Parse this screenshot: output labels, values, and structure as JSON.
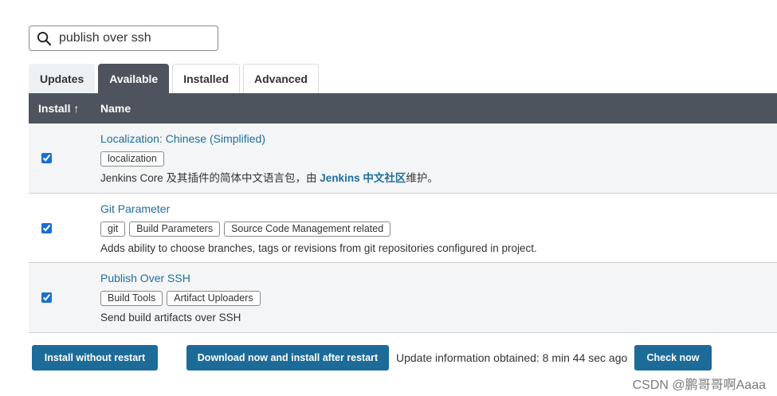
{
  "search": {
    "value": "publish over ssh",
    "icon": "search-icon"
  },
  "tabs": [
    {
      "label": "Updates",
      "active": false
    },
    {
      "label": "Available",
      "active": true
    },
    {
      "label": "Installed",
      "active": false
    },
    {
      "label": "Advanced",
      "active": false
    }
  ],
  "table": {
    "headers": {
      "install": "Install ↑",
      "name": "Name"
    },
    "rows": [
      {
        "name": "Localization: Chinese (Simplified)",
        "checked": true,
        "labels": [
          "localization"
        ],
        "description_prefix": "Jenkins Core 及其插件的简体中文语言包，由 ",
        "description_link": "Jenkins 中文社区",
        "description_suffix": "维护。"
      },
      {
        "name": "Git Parameter",
        "checked": true,
        "labels": [
          "git",
          "Build Parameters",
          "Source Code Management related"
        ],
        "description": "Adds ability to choose branches, tags or revisions from git repositories configured in project."
      },
      {
        "name": "Publish Over SSH",
        "checked": true,
        "labels": [
          "Build Tools",
          "Artifact Uploaders"
        ],
        "description": "Send build artifacts over SSH"
      }
    ]
  },
  "footer": {
    "install_button": "Install without restart",
    "download_button": "Download now and install after restart",
    "update_info": "Update information obtained: 8 min 44 sec ago",
    "check_button": "Check now"
  },
  "watermark": "CSDN @鹏哥哥啊Aaaa",
  "colors": {
    "header_bg": "#4d545d",
    "button_bg": "#1d6b99",
    "link": "#1f6e9c"
  }
}
